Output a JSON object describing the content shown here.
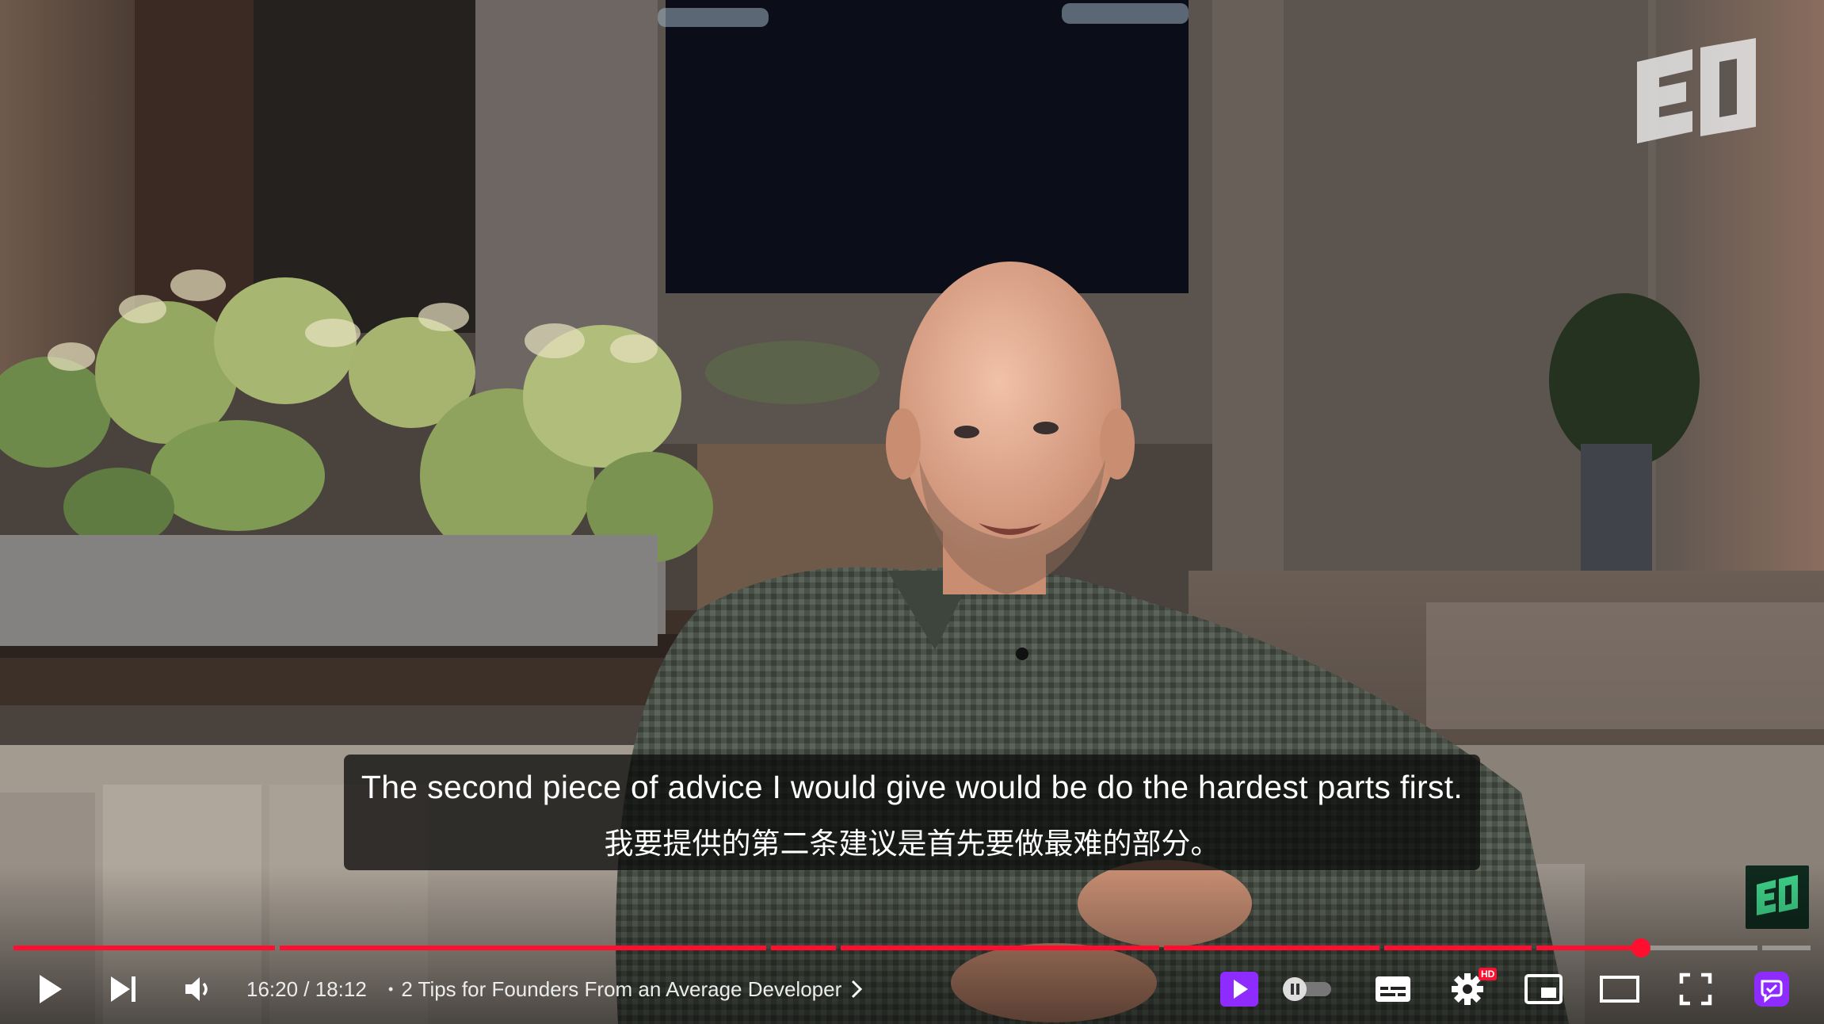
{
  "captions": {
    "line1": "The second piece of advice I would give would be do the hardest parts first.",
    "line2": "我要提供的第二条建议是首先要做最难的部分。"
  },
  "player": {
    "current_time": "16:20",
    "separator": " / ",
    "duration": "18:12",
    "chapter_bullet": "•",
    "chapter_title": "2 Tips for Founders From an Average Developer",
    "progress_fraction": 0.898,
    "hd_badge": "HD"
  },
  "colors": {
    "progress_played": "#ff0f2f",
    "accent_purple": "#8e2bff",
    "brand_green": "#3ed389"
  },
  "icons": {
    "play": "play-icon",
    "next": "skip-next-icon",
    "volume": "volume-icon",
    "chapter_chevron": "chevron-right-icon",
    "extension": "purple-play-icon",
    "autoplay": "autoplay-toggle-icon",
    "subtitles": "subtitles-icon",
    "settings": "gear-icon",
    "miniplayer": "miniplayer-icon",
    "theater": "theater-mode-icon",
    "fullscreen": "fullscreen-icon",
    "translate_ext": "translate-extension-icon"
  }
}
